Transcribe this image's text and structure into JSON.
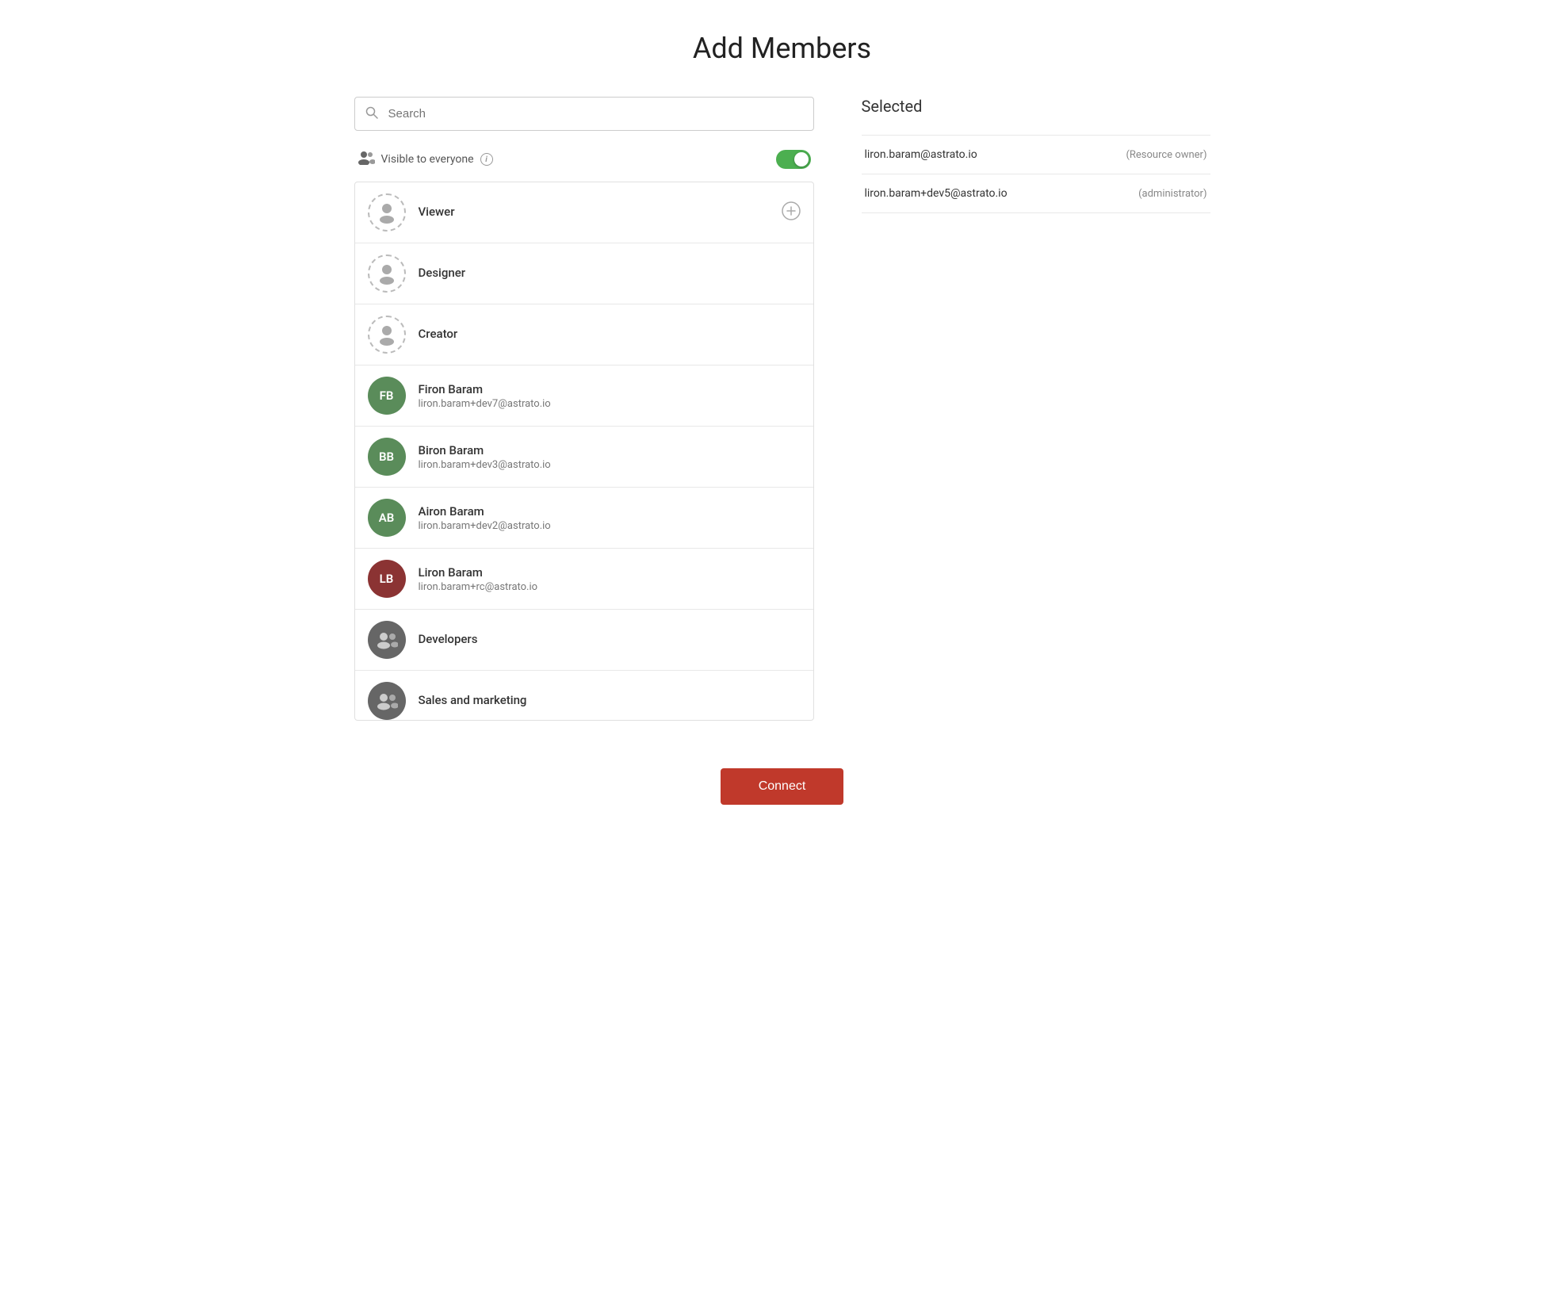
{
  "page": {
    "title": "Add Members"
  },
  "search": {
    "placeholder": "Search",
    "value": ""
  },
  "visible_to_everyone": {
    "label": "Visible to everyone",
    "toggle_on": true
  },
  "member_list": [
    {
      "id": "viewer",
      "type": "role",
      "name": "Viewer",
      "email": "",
      "avatar_type": "dashed",
      "initials": "",
      "color": "",
      "has_add": true
    },
    {
      "id": "designer",
      "type": "role",
      "name": "Designer",
      "email": "",
      "avatar_type": "dashed",
      "initials": "",
      "color": "",
      "has_add": false
    },
    {
      "id": "creator",
      "type": "role",
      "name": "Creator",
      "email": "",
      "avatar_type": "dashed",
      "initials": "",
      "color": "",
      "has_add": false
    },
    {
      "id": "firon-baram",
      "type": "user",
      "name": "Firon Baram",
      "email": "liron.baram+dev7@astrato.io",
      "avatar_type": "initials",
      "initials": "FB",
      "color": "#5a8c5a",
      "has_add": false
    },
    {
      "id": "biron-baram",
      "type": "user",
      "name": "Biron Baram",
      "email": "liron.baram+dev3@astrato.io",
      "avatar_type": "initials",
      "initials": "BB",
      "color": "#5a8c5a",
      "has_add": false
    },
    {
      "id": "airon-baram",
      "type": "user",
      "name": "Airon Baram",
      "email": "liron.baram+dev2@astrato.io",
      "avatar_type": "initials",
      "initials": "AB",
      "color": "#5a8c5a",
      "has_add": false
    },
    {
      "id": "liron-baram",
      "type": "user",
      "name": "Liron Baram",
      "email": "liron.baram+rc@astrato.io",
      "avatar_type": "initials",
      "initials": "LB",
      "color": "#8b3333",
      "has_add": false
    },
    {
      "id": "developers",
      "type": "group",
      "name": "Developers",
      "email": "",
      "avatar_type": "group",
      "initials": "",
      "color": "",
      "has_add": false
    },
    {
      "id": "sales-marketing",
      "type": "group",
      "name": "Sales and marketing",
      "email": "",
      "avatar_type": "group",
      "initials": "",
      "color": "",
      "has_add": false
    }
  ],
  "selected": {
    "title": "Selected",
    "items": [
      {
        "email": "liron.baram@astrato.io",
        "role": "(Resource owner)"
      },
      {
        "email": "liron.baram+dev5@astrato.io",
        "role": "(administrator)"
      }
    ]
  },
  "connect_button": {
    "label": "Connect"
  }
}
